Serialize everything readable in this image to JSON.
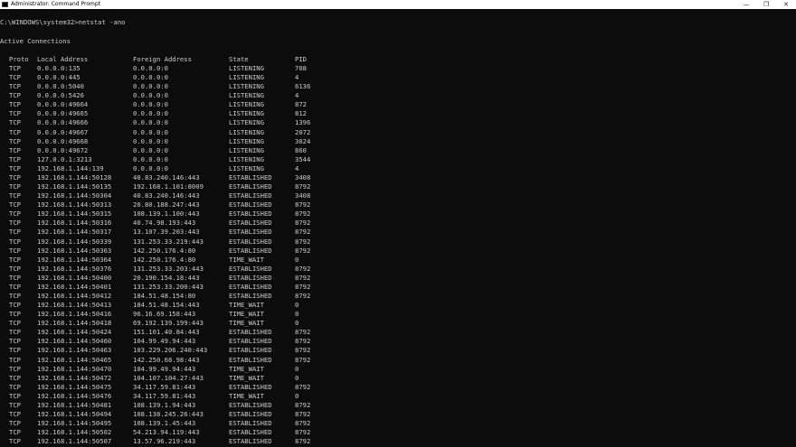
{
  "window": {
    "title": "Administrator: Command Prompt",
    "controls": {
      "minimize": "—",
      "restore": "❐",
      "close": "✕"
    }
  },
  "console": {
    "prompt_line": "C:\\WINDOWS\\system32>netstat -ano",
    "section_title": "Active Connections",
    "headers": {
      "proto": "Proto",
      "local": "Local Address",
      "foreign": "Foreign Address",
      "state": "State",
      "pid": "PID"
    },
    "rows": [
      [
        "TCP",
        "0.0.0.0:135",
        "0.0.0.0:0",
        "LISTENING",
        "708"
      ],
      [
        "TCP",
        "0.0.0.0:445",
        "0.0.0.0:0",
        "LISTENING",
        "4"
      ],
      [
        "TCP",
        "0.0.0.0:5040",
        "0.0.0.0:0",
        "LISTENING",
        "6136"
      ],
      [
        "TCP",
        "0.0.0.0:5426",
        "0.0.0.0:0",
        "LISTENING",
        "4"
      ],
      [
        "TCP",
        "0.0.0.0:49664",
        "0.0.0.0:0",
        "LISTENING",
        "872"
      ],
      [
        "TCP",
        "0.0.0.0:49665",
        "0.0.0.0:0",
        "LISTENING",
        "812"
      ],
      [
        "TCP",
        "0.0.0.0:49666",
        "0.0.0.0:0",
        "LISTENING",
        "1396"
      ],
      [
        "TCP",
        "0.0.0.0:49667",
        "0.0.0.0:0",
        "LISTENING",
        "2072"
      ],
      [
        "TCP",
        "0.0.0.0:49668",
        "0.0.0.0:0",
        "LISTENING",
        "3024"
      ],
      [
        "TCP",
        "0.0.0.0:49672",
        "0.0.0.0:0",
        "LISTENING",
        "860"
      ],
      [
        "TCP",
        "127.0.0.1:3213",
        "0.0.0.0:0",
        "LISTENING",
        "3544"
      ],
      [
        "TCP",
        "192.168.1.144:139",
        "0.0.0.0:0",
        "LISTENING",
        "4"
      ],
      [
        "TCP",
        "192.168.1.144:50128",
        "40.83.240.146:443",
        "ESTABLISHED",
        "3408"
      ],
      [
        "TCP",
        "192.168.1.144:50135",
        "192.168.1.101:8009",
        "ESTABLISHED",
        "8792"
      ],
      [
        "TCP",
        "192.168.1.144:50304",
        "40.83.240.146:443",
        "ESTABLISHED",
        "3408"
      ],
      [
        "TCP",
        "192.168.1.144:50313",
        "20.80.188.247:443",
        "ESTABLISHED",
        "8792"
      ],
      [
        "TCP",
        "192.168.1.144:50315",
        "108.139.1.100:443",
        "ESTABLISHED",
        "8792"
      ],
      [
        "TCP",
        "192.168.1.144:50316",
        "40.74.98.193:443",
        "ESTABLISHED",
        "8792"
      ],
      [
        "TCP",
        "192.168.1.144:50317",
        "13.107.39.203:443",
        "ESTABLISHED",
        "8792"
      ],
      [
        "TCP",
        "192.168.1.144:50339",
        "131.253.33.219:443",
        "ESTABLISHED",
        "8792"
      ],
      [
        "TCP",
        "192.168.1.144:50363",
        "142.250.176.4:80",
        "ESTABLISHED",
        "8792"
      ],
      [
        "TCP",
        "192.168.1.144:50364",
        "142.250.176.4:80",
        "TIME_WAIT",
        "0"
      ],
      [
        "TCP",
        "192.168.1.144:50376",
        "131.253.33.203:443",
        "ESTABLISHED",
        "8792"
      ],
      [
        "TCP",
        "192.168.1.144:50400",
        "20.190.154.18:443",
        "ESTABLISHED",
        "8792"
      ],
      [
        "TCP",
        "192.168.1.144:50401",
        "131.253.33.200:443",
        "ESTABLISHED",
        "8792"
      ],
      [
        "TCP",
        "192.168.1.144:50412",
        "184.51.48.154:80",
        "ESTABLISHED",
        "8792"
      ],
      [
        "TCP",
        "192.168.1.144:50413",
        "184.51.48.154:443",
        "TIME_WAIT",
        "0"
      ],
      [
        "TCP",
        "192.168.1.144:50416",
        "96.16.69.158:443",
        "TIME_WAIT",
        "0"
      ],
      [
        "TCP",
        "192.168.1.144:50418",
        "69.192.139.199:443",
        "TIME_WAIT",
        "0"
      ],
      [
        "TCP",
        "192.168.1.144:50424",
        "151.101.40.84:443",
        "ESTABLISHED",
        "8792"
      ],
      [
        "TCP",
        "192.168.1.144:50460",
        "104.99.49.94:443",
        "ESTABLISHED",
        "8792"
      ],
      [
        "TCP",
        "192.168.1.144:50463",
        "103.229.206.240:443",
        "ESTABLISHED",
        "8792"
      ],
      [
        "TCP",
        "192.168.1.144:50465",
        "142.250.68.98:443",
        "ESTABLISHED",
        "8792"
      ],
      [
        "TCP",
        "192.168.1.144:50470",
        "104.99.49.94:443",
        "TIME_WAIT",
        "0"
      ],
      [
        "TCP",
        "192.168.1.144:50472",
        "104.107.104.27:443",
        "TIME_WAIT",
        "0"
      ],
      [
        "TCP",
        "192.168.1.144:50475",
        "34.117.59.81:443",
        "ESTABLISHED",
        "8792"
      ],
      [
        "TCP",
        "192.168.1.144:50476",
        "34.117.59.81:443",
        "TIME_WAIT",
        "0"
      ],
      [
        "TCP",
        "192.168.1.144:50481",
        "108.139.1.94:443",
        "ESTABLISHED",
        "8792"
      ],
      [
        "TCP",
        "192.168.1.144:50494",
        "108.138.245.26:443",
        "ESTABLISHED",
        "8792"
      ],
      [
        "TCP",
        "192.168.1.144:50495",
        "108.139.1.45:443",
        "ESTABLISHED",
        "8792"
      ],
      [
        "TCP",
        "192.168.1.144:50502",
        "54.213.94.119:443",
        "ESTABLISHED",
        "8792"
      ],
      [
        "TCP",
        "192.168.1.144:50507",
        "13.57.96.219:443",
        "ESTABLISHED",
        "8792"
      ]
    ]
  }
}
